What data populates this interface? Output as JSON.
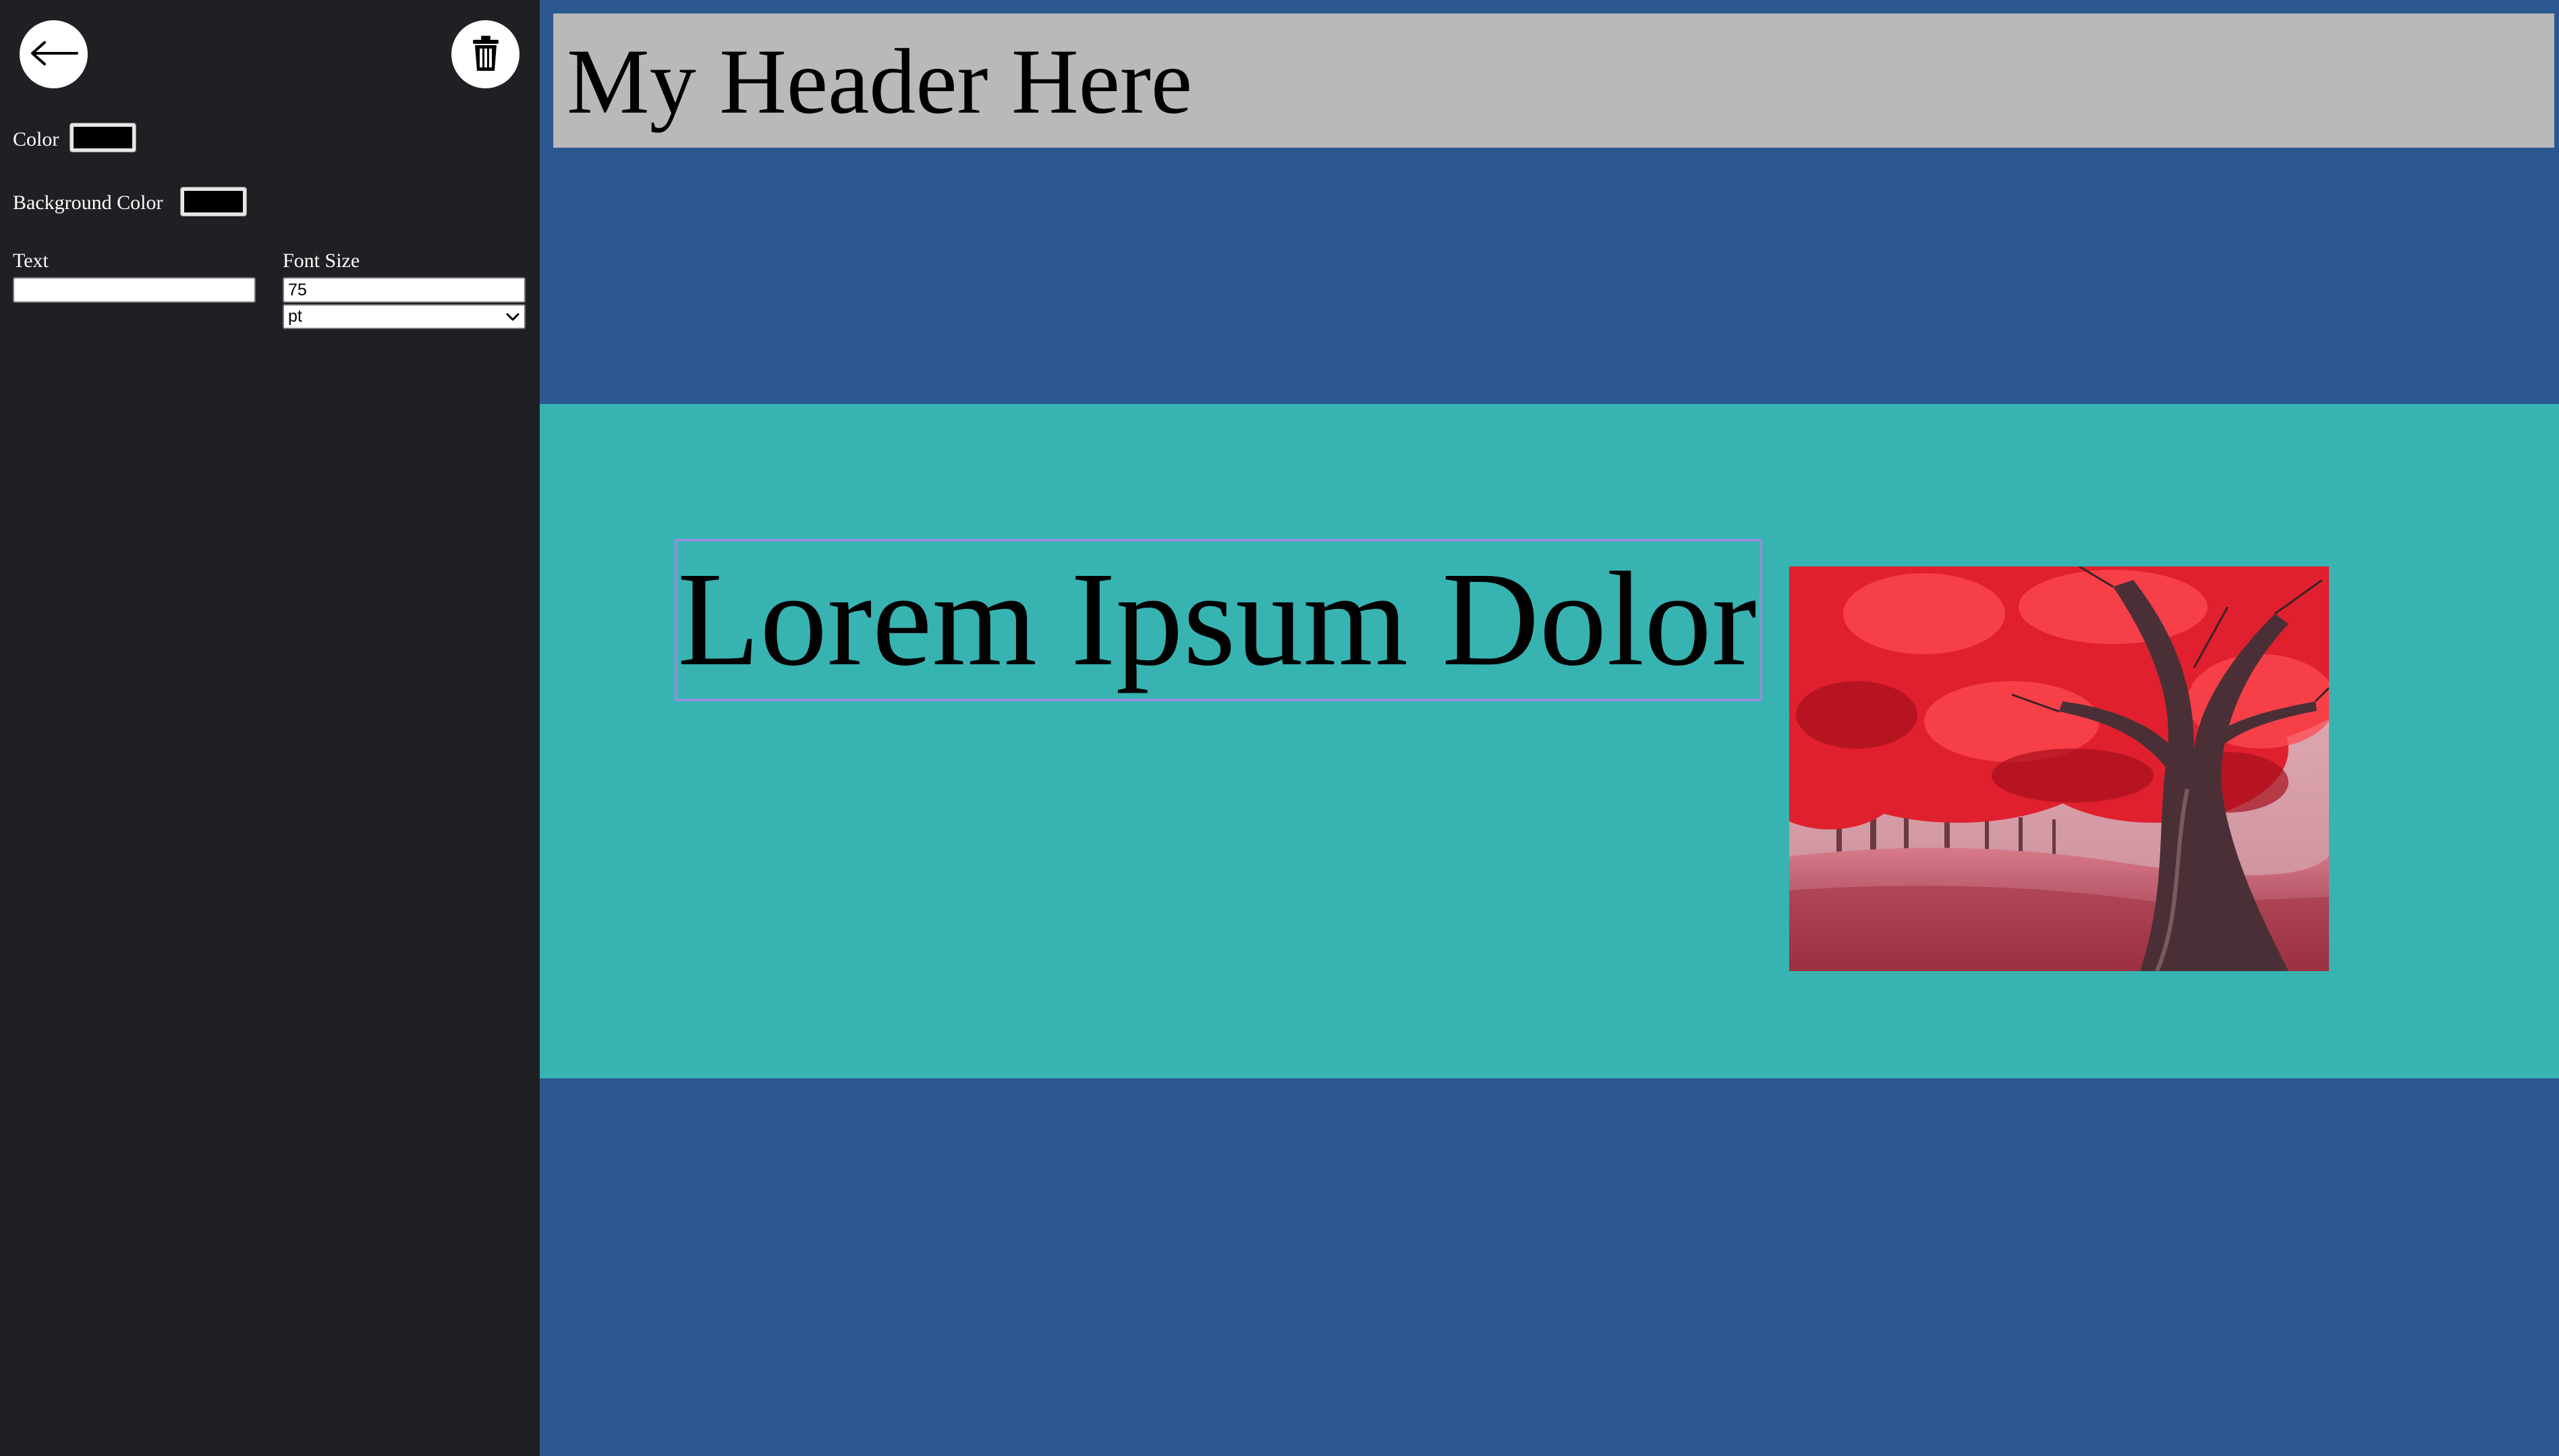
{
  "sidebar": {
    "back_icon": "left-arrow-icon",
    "delete_icon": "trash-icon",
    "color_label": "Color",
    "color_value": "#000000",
    "background_color_label": "Background Color",
    "background_color_value": "#000000",
    "text_label": "Text",
    "text_value": "",
    "font_size_label": "Font Size",
    "font_size_value": "75",
    "font_size_unit": "pt"
  },
  "canvas": {
    "header_text": "My Header Here",
    "main_text": "Lorem Ipsum Dolor",
    "colors": {
      "page_background": "#2b5890",
      "header_background": "#b9b9b9",
      "section_background": "#37b3b2",
      "selection_outline": "#8f8fd6"
    }
  }
}
